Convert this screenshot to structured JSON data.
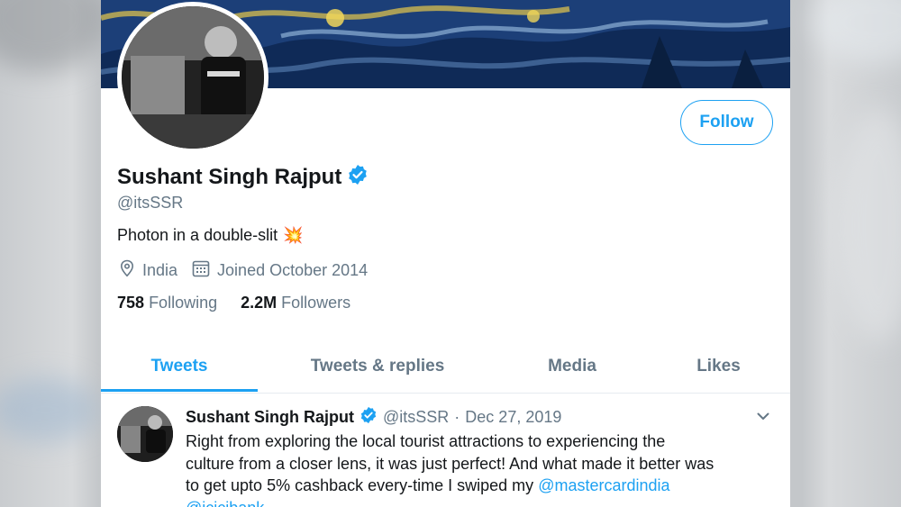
{
  "profile": {
    "name": "Sushant Singh Rajput",
    "handle": "@itsSSR",
    "bio": "Photon in a double-slit",
    "bio_emoji": "💥",
    "location": "India",
    "joined": "Joined October 2014",
    "following_count": "758",
    "following_label": "Following",
    "followers_count": "2.2M",
    "followers_label": "Followers",
    "follow_button": "Follow",
    "verified_icon": "verified-badge-icon"
  },
  "tabs": [
    {
      "label": "Tweets",
      "active": true
    },
    {
      "label": "Tweets & replies",
      "active": false
    },
    {
      "label": "Media",
      "active": false
    },
    {
      "label": "Likes",
      "active": false
    }
  ],
  "tweet": {
    "author": "Sushant Singh Rajput",
    "handle": "@itsSSR",
    "separator": "·",
    "date": "Dec 27, 2019",
    "text_line1": "Right from exploring the local tourist attractions to experiencing the",
    "text_line2": "culture from a closer lens, it was just perfect! And what made it better was",
    "text_line3": "to get upto 5% cashback every-time I swiped my ",
    "mention1": "@mastercardindia",
    "mention2": "@icicibank"
  },
  "colors": {
    "accent": "#1da1f2",
    "text": "#14171a",
    "muted": "#657786"
  }
}
